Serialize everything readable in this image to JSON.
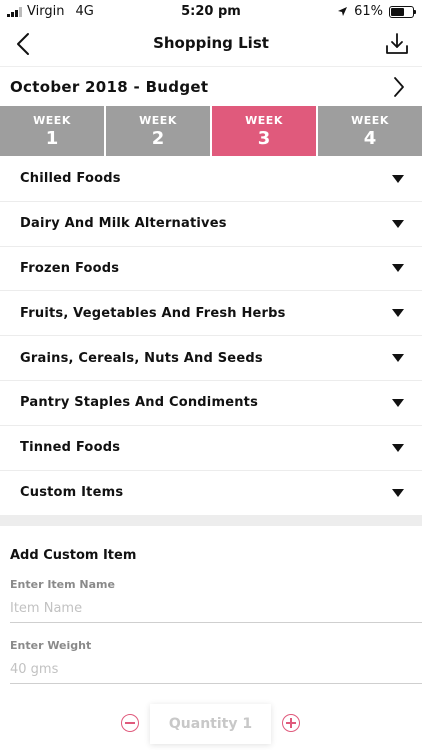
{
  "status_bar": {
    "carrier": "Virgin",
    "network": "4G",
    "time": "5:20 pm",
    "battery_percent": "61%",
    "battery_level": 0.61
  },
  "nav": {
    "title": "Shopping List",
    "back_icon": "chevron-left-icon",
    "download_icon": "download-icon"
  },
  "budget": {
    "title": "October 2018 - Budget",
    "next_icon": "chevron-right-icon"
  },
  "weeks": [
    {
      "label": "WEEK",
      "number": "1",
      "active": false
    },
    {
      "label": "WEEK",
      "number": "2",
      "active": false
    },
    {
      "label": "WEEK",
      "number": "3",
      "active": true
    },
    {
      "label": "WEEK",
      "number": "4",
      "active": false
    }
  ],
  "categories": [
    {
      "label": "Chilled Foods"
    },
    {
      "label": "Dairy And Milk Alternatives"
    },
    {
      "label": "Frozen Foods"
    },
    {
      "label": "Fruits, Vegetables And Fresh Herbs"
    },
    {
      "label": "Grains, Cereals, Nuts And Seeds"
    },
    {
      "label": "Pantry Staples And Condiments"
    },
    {
      "label": "Tinned Foods"
    },
    {
      "label": "Custom Items"
    }
  ],
  "custom_item": {
    "title": "Add Custom Item",
    "name_label": "Enter Item Name",
    "name_placeholder": "Item Name",
    "weight_label": "Enter Weight",
    "weight_placeholder": "40 gms",
    "quantity_label": "Quantity 1"
  },
  "colors": {
    "accent": "#e05a7c",
    "week_inactive": "#9e9e9e",
    "divider": "#ededed"
  }
}
